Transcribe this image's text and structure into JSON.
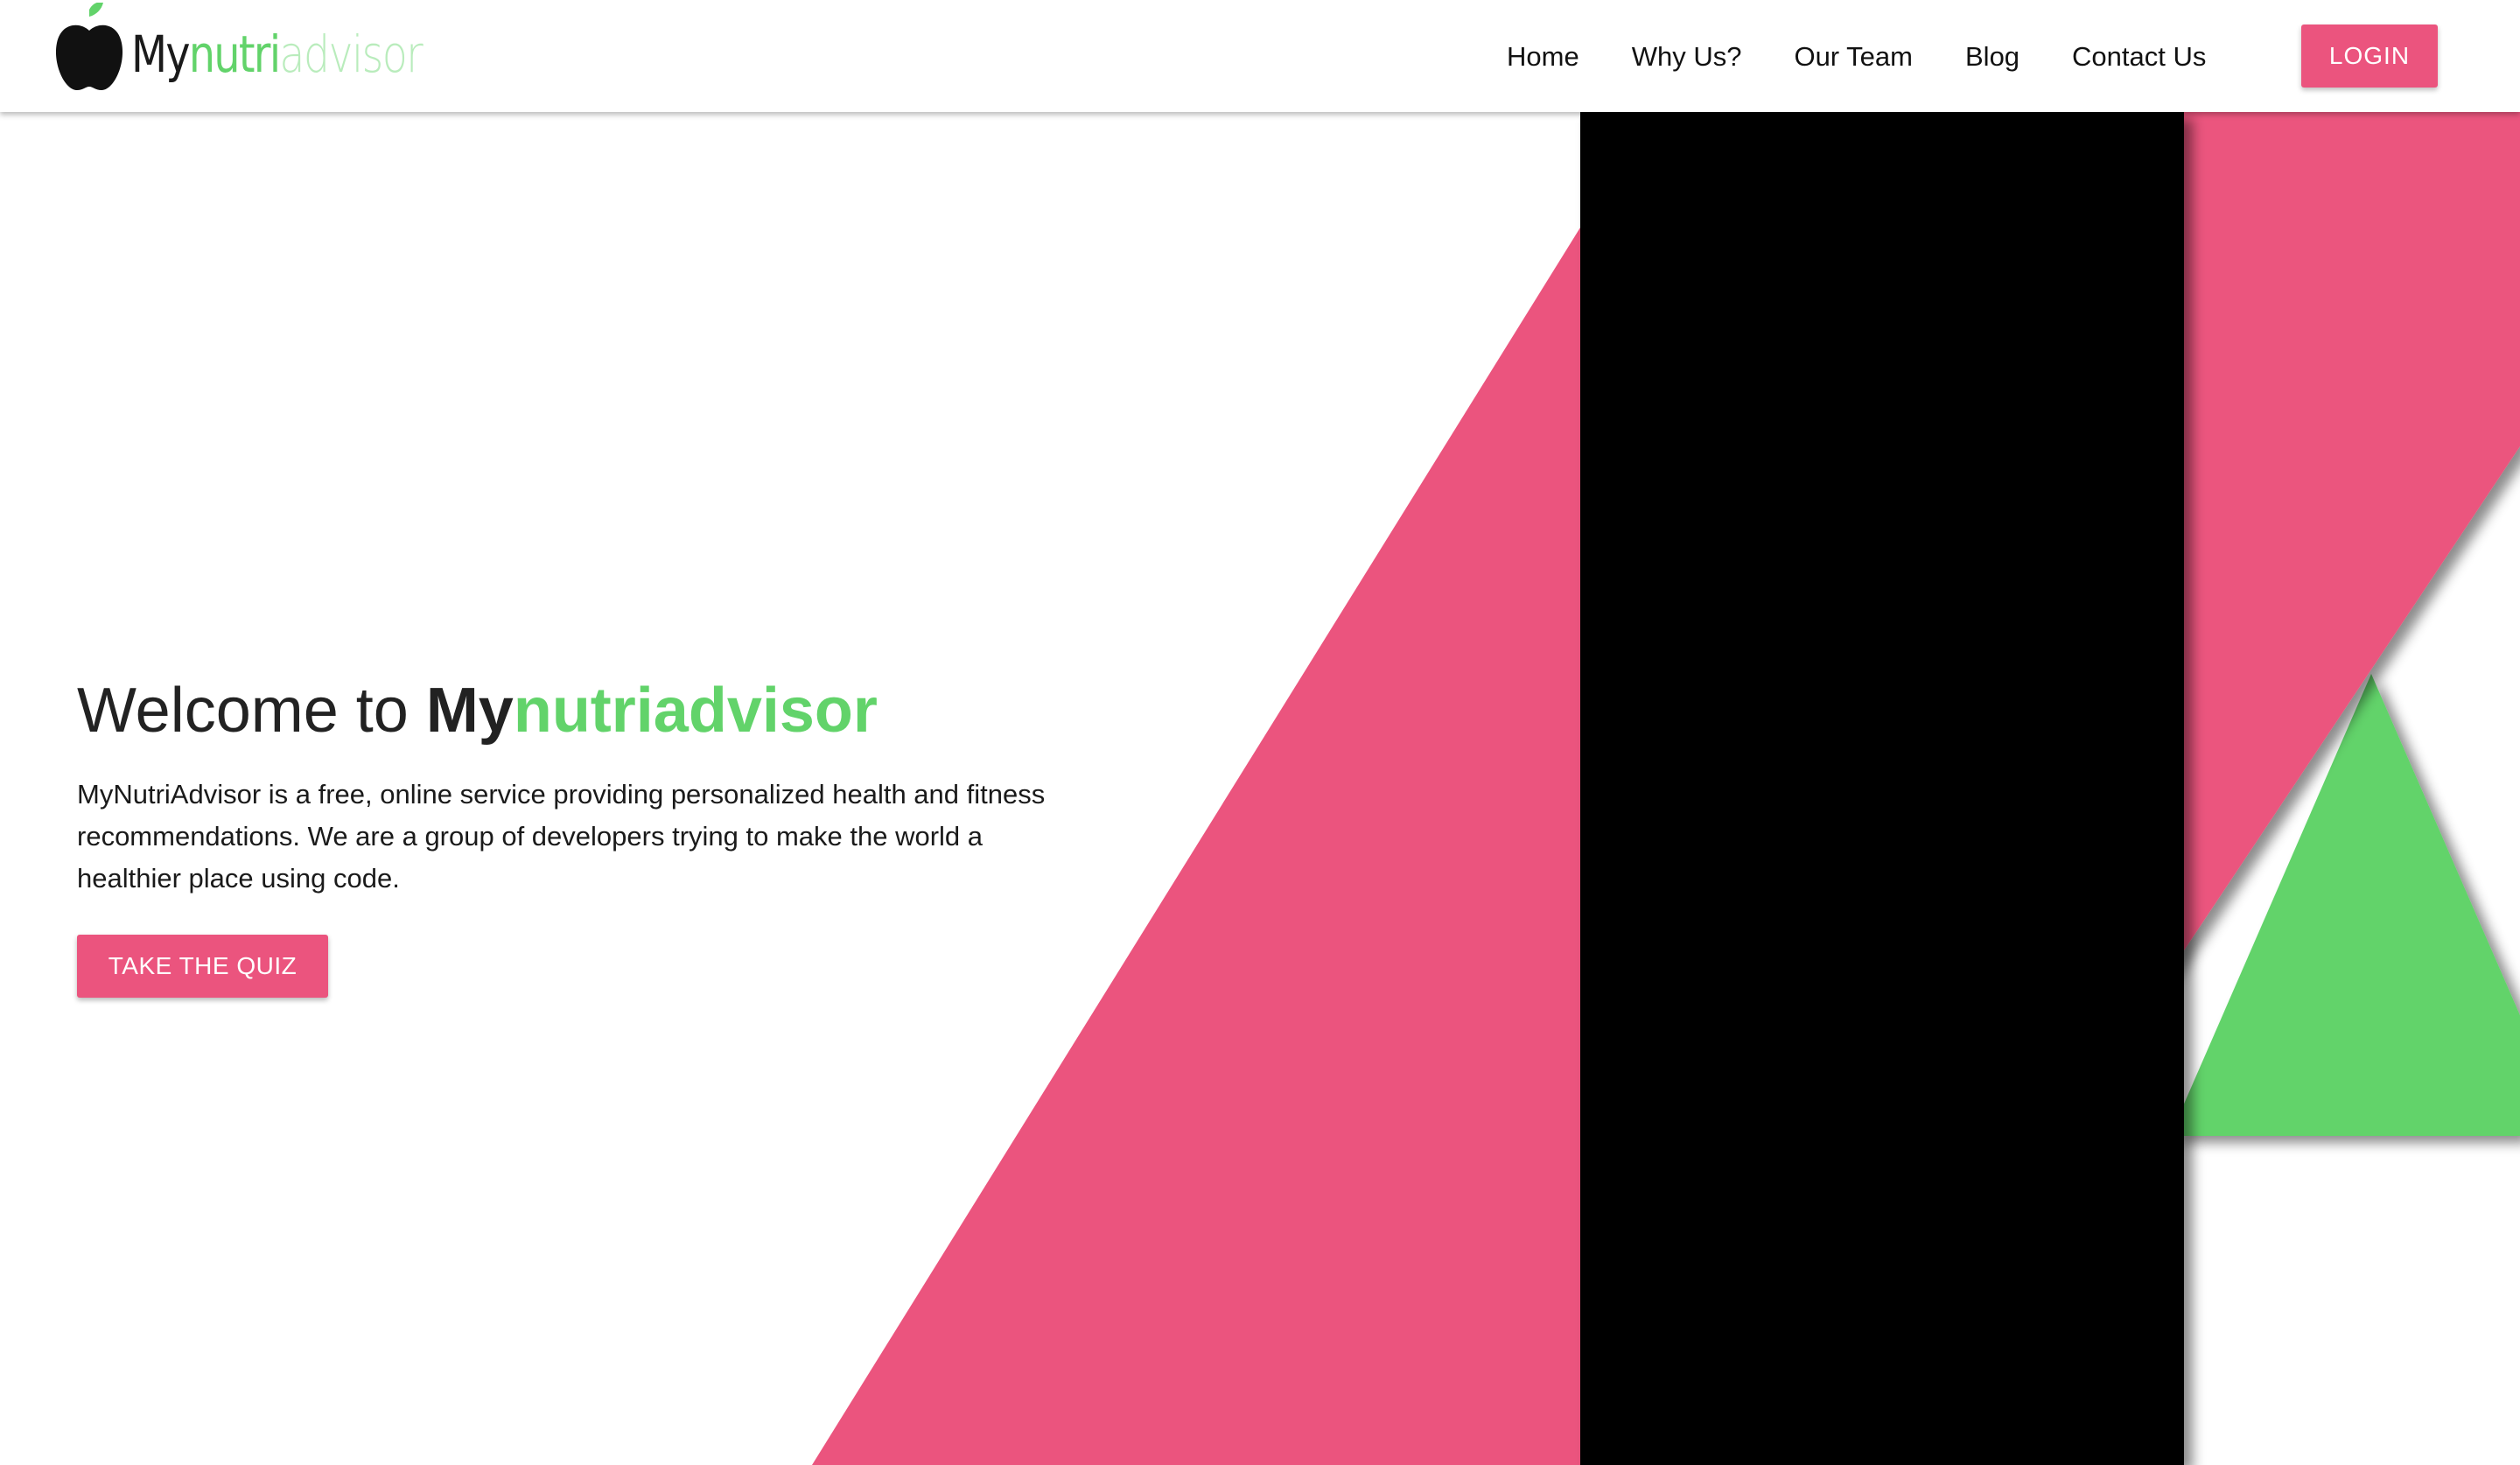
{
  "brand": {
    "logo_icon": "apple-icon",
    "name_part1": "My",
    "name_part2": "nutri",
    "name_part3": "advisor"
  },
  "nav": {
    "items": [
      {
        "label": "Home"
      },
      {
        "label": "Why Us?"
      },
      {
        "label": "Our Team"
      },
      {
        "label": "Blog"
      },
      {
        "label": "Contact Us"
      }
    ],
    "login_label": "LOGIN"
  },
  "hero": {
    "title_prefix": "Welcome to ",
    "title_brand_bold": "My",
    "title_brand_green": "nutriadvisor",
    "description": "MyNutriAdvisor is a free, online service providing personalized health and fitness recommendations. We are a group of developers trying to make the world a healthier place using code.",
    "cta_label": "TAKE THE QUIZ"
  },
  "colors": {
    "accent_pink": "#eb547e",
    "accent_green": "#62d36a",
    "light_green": "#b9ecbc",
    "black": "#000000"
  }
}
